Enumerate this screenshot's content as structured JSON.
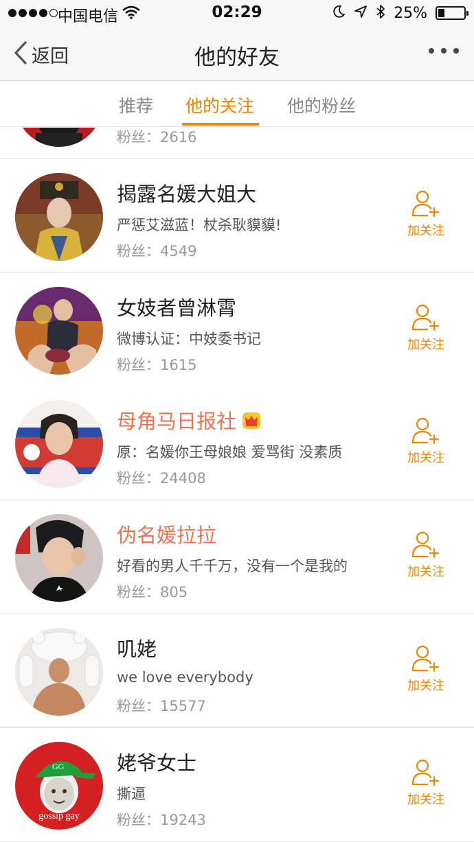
{
  "status_bar": {
    "carrier": "中国电信",
    "time": "02:29",
    "battery_text": "25%",
    "battery_level": 0.25
  },
  "nav": {
    "back_label": "返回",
    "title": "他的好友"
  },
  "tabs": [
    {
      "label": "推荐",
      "active": false
    },
    {
      "label": "他的关注",
      "active": true
    },
    {
      "label": "他的粉丝",
      "active": false
    }
  ],
  "partial_row": {
    "fans_label": "粉丝：",
    "fans": "2616"
  },
  "users": [
    {
      "name": "揭露名媛大姐大",
      "desc": "严惩艾滋蓝！杖杀耿貘貘!",
      "fans_label": "粉丝：",
      "fans": "4549",
      "follow_label": "加关注",
      "vip": false
    },
    {
      "name": "女妓者曾淋霄",
      "desc": "微博认证：中妓委书记",
      "fans_label": "粉丝：",
      "fans": "1615",
      "follow_label": "加关注",
      "vip": false
    },
    {
      "name": "母角马日报社",
      "desc": "原：名媛你王母娘娘  爱骂街 没素质",
      "fans_label": "粉丝：",
      "fans": "24408",
      "follow_label": "加关注",
      "vip": true
    },
    {
      "name": "伪名媛拉拉",
      "desc": "好看的男人千千万，没有一个是我的",
      "fans_label": "粉丝：",
      "fans": "805",
      "follow_label": "加关注",
      "vip": true
    },
    {
      "name": "叽姥",
      "desc": "we love everybody",
      "fans_label": "粉丝：",
      "fans": "15577",
      "follow_label": "加关注",
      "vip": false
    },
    {
      "name": "姥爷女士",
      "desc": "撕逼",
      "fans_label": "粉丝：",
      "fans": "19243",
      "follow_label": "加关注",
      "vip": false
    }
  ],
  "avatar_6_text": {
    "cap": "GG",
    "caption": "gossip gay"
  },
  "colors": {
    "accent": "#f08300",
    "vip_name": "#eb7350"
  }
}
